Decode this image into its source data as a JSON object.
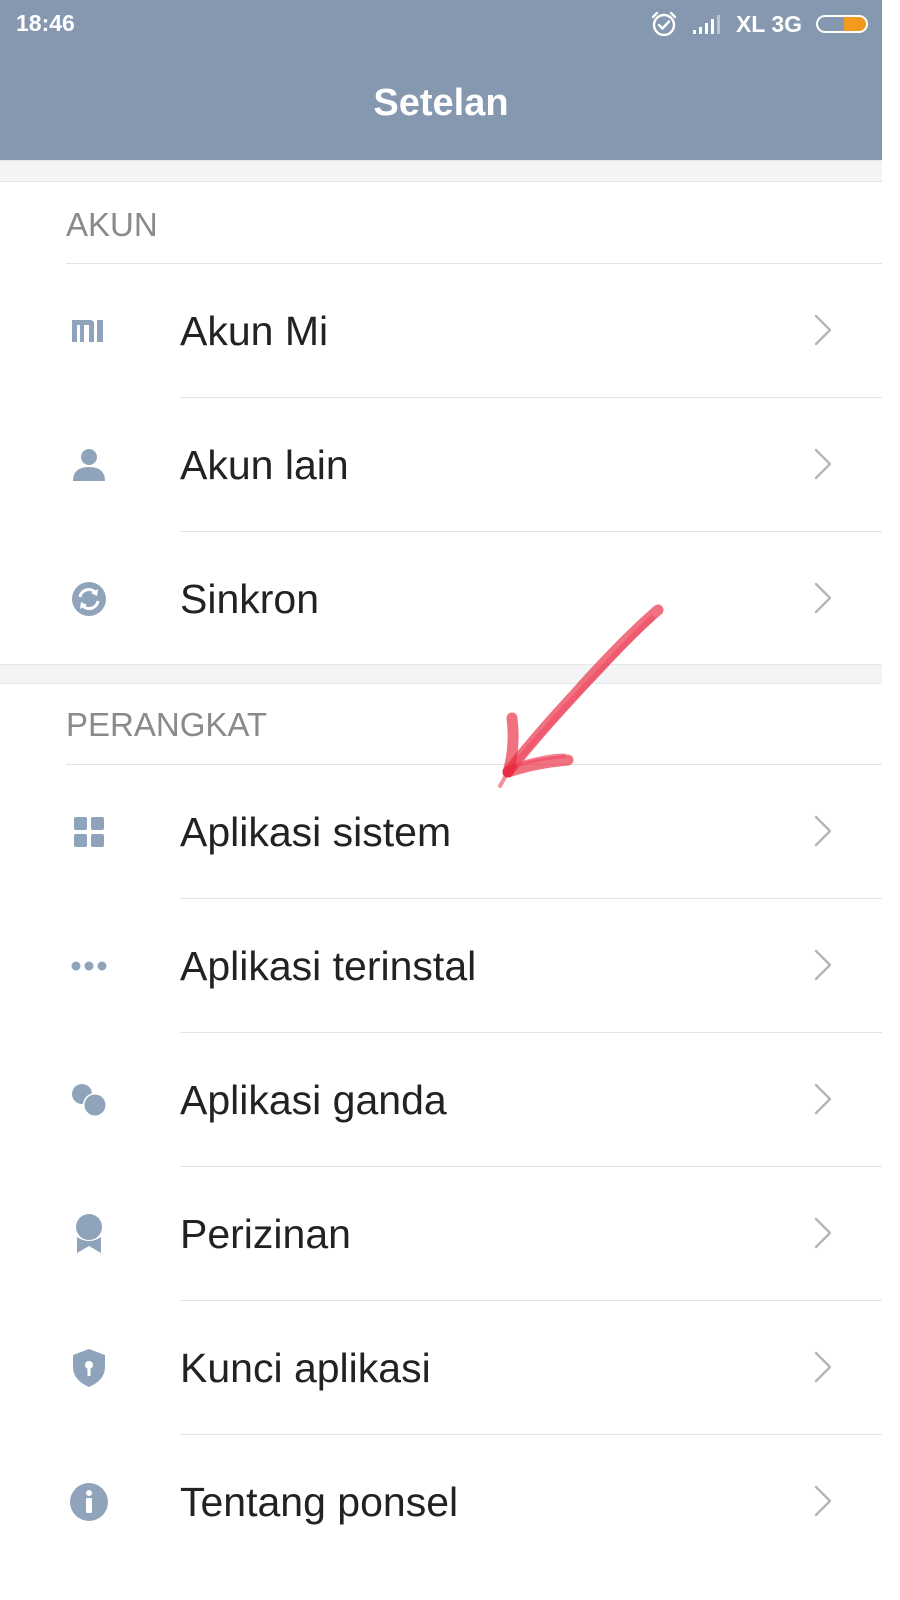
{
  "status_bar": {
    "time": "18:46",
    "carrier": "XL 3G",
    "icons": [
      "alarm-icon",
      "signal-icon",
      "battery-icon"
    ],
    "battery_level": 0.45
  },
  "header": {
    "title": "Setelan"
  },
  "sections": [
    {
      "title": "AKUN",
      "items": [
        {
          "label": "Akun Mi",
          "icon": "mi-logo-icon"
        },
        {
          "label": "Akun lain",
          "icon": "person-icon"
        },
        {
          "label": "Sinkron",
          "icon": "sync-icon"
        }
      ]
    },
    {
      "title": "PERANGKAT",
      "items": [
        {
          "label": "Aplikasi sistem",
          "icon": "grid-icon"
        },
        {
          "label": "Aplikasi terinstal",
          "icon": "more-dots-icon"
        },
        {
          "label": "Aplikasi ganda",
          "icon": "dual-apps-icon"
        },
        {
          "label": "Perizinan",
          "icon": "badge-icon"
        },
        {
          "label": "Kunci aplikasi",
          "icon": "shield-lock-icon"
        },
        {
          "label": "Tentang ponsel",
          "icon": "info-icon"
        }
      ]
    }
  ],
  "colors": {
    "header_bg": "#8598b0",
    "icon": "#8fa4bb",
    "section_title": "#8a8a8a",
    "label": "#222222",
    "chevron": "#b5b5b5",
    "battery_fill": "#f39a1e",
    "annotation": "#e8263c"
  }
}
